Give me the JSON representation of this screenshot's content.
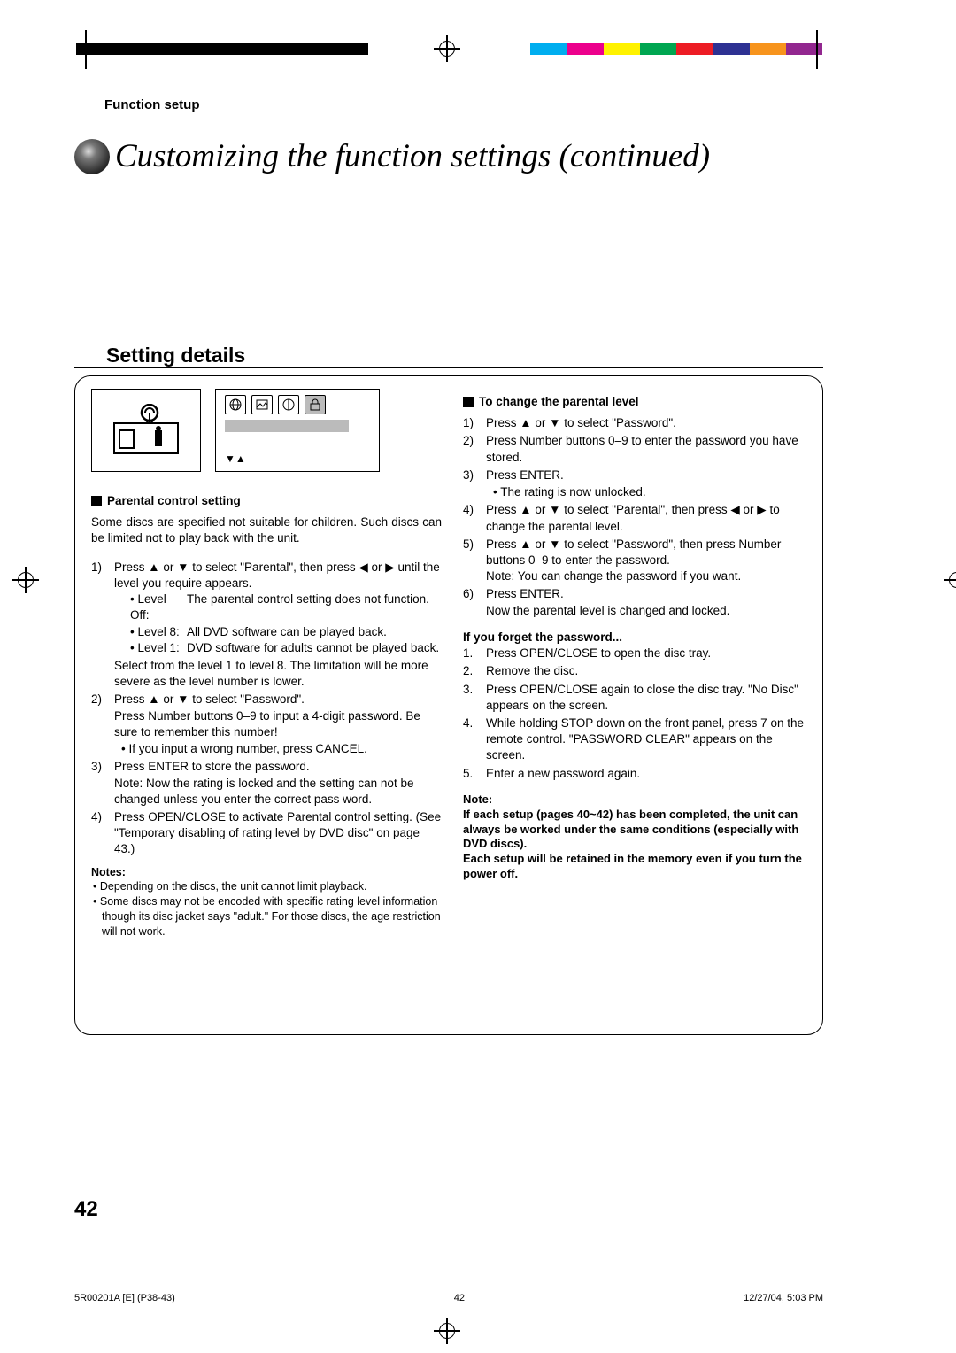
{
  "header": "Function setup",
  "title": "Customizing the function settings (continued)",
  "section": "Setting details",
  "left": {
    "h1": "Parental control setting",
    "intro": "Some discs are specified not suitable for children. Such discs can be limited not to play back with the unit.",
    "s1n": "1)",
    "s1": "Press ▲ or ▼ to select \"Parental\", then press ◀ or ▶ until the level you require appears.",
    "lvOffN": "• Level Off:",
    "lvOff": "The parental control setting does not function.",
    "lv8N": "• Level 8:",
    "lv8": "All DVD software can be played back.",
    "lv1N": "• Level 1:",
    "lv1": "DVD software for adults cannot be played back.",
    "sel": "Select from the level 1 to level 8. The limitation will be more severe as the level number is lower.",
    "s2n": "2)",
    "s2a": "Press ▲ or ▼ to select \"Password\".",
    "s2b": "Press Number buttons 0–9 to input a 4-digit password. Be sure to remember this number!",
    "s2c": "If you input a wrong number, press CANCEL.",
    "s3n": "3)",
    "s3a": "Press ENTER to store the password.",
    "s3b": "Note: Now the rating is locked and the setting can not be changed unless you enter the correct pass word.",
    "s4n": "4)",
    "s4": "Press OPEN/CLOSE to activate Parental control setting. (See \"Temporary disabling of rating level by DVD disc\" on page 43.)",
    "notesH": "Notes:",
    "note1": "Depending on the discs, the unit cannot limit playback.",
    "note2": "Some discs may not be encoded with specific rating level information though its disc jacket says \"adult.\" For those discs, the age restriction will not work."
  },
  "right": {
    "h1": "To change the parental level",
    "r1n": "1)",
    "r1": "Press ▲ or ▼ to select \"Password\".",
    "r2n": "2)",
    "r2": "Press Number buttons 0–9 to enter the password you have stored.",
    "r3n": "3)",
    "r3a": "Press ENTER.",
    "r3b": "The rating is now unlocked.",
    "r4n": "4)",
    "r4": "Press ▲ or ▼ to select \"Parental\", then press ◀ or ▶ to change the parental level.",
    "r5n": "5)",
    "r5a": "Press ▲ or ▼ to select \"Password\", then press Number buttons 0–9 to enter the password.",
    "r5b": "Note: You can change the password if you want.",
    "r6n": "6)",
    "r6a": "Press ENTER.",
    "r6b": "Now the parental level is changed and locked.",
    "forgotH": "If you forget the password...",
    "f1n": "1.",
    "f1": "Press OPEN/CLOSE to open the disc tray.",
    "f2n": "2.",
    "f2": "Remove the disc.",
    "f3n": "3.",
    "f3": "Press OPEN/CLOSE again to close the disc tray. \"No Disc\" appears on the screen.",
    "f4n": "4.",
    "f4": "While holding STOP down on the front panel, press 7 on the remote control. \"PASSWORD CLEAR\" appears on the screen.",
    "f5n": "5.",
    "f5": "Enter a new password again.",
    "bigNoteH": "Note:",
    "bigNote1": "If each setup (pages 40~42) has been completed, the unit can always be worked under the same conditions (especially with DVD discs).",
    "bigNote2": "Each setup will be retained in the memory even if you turn the power off."
  },
  "pagenum": "42",
  "footer": {
    "left": "5R00201A [E] (P38-43)",
    "mid": "42",
    "right": "12/27/04, 5:03 PM"
  }
}
